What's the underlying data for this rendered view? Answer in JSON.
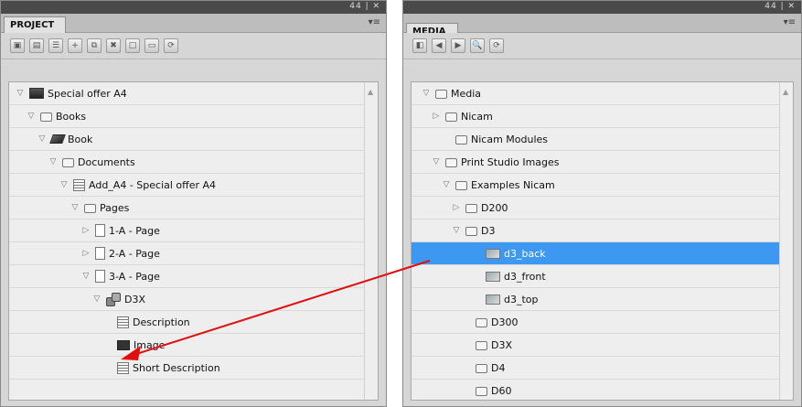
{
  "window_controls": "44 | ✕",
  "project_panel": {
    "tab_label": "PROJECT",
    "menu_icon": "▾≡",
    "toolbar_buttons": [
      "save-icon",
      "save-as-icon",
      "properties-icon",
      "add-icon",
      "duplicate-icon",
      "delete-icon",
      "new-page-icon",
      "preview-icon",
      "refresh-icon"
    ],
    "tree": [
      {
        "label": "Special offer A4",
        "icon": "dark-box-icon",
        "expander": "▽",
        "depth": 0
      },
      {
        "label": "Books",
        "icon": "folder-icon",
        "expander": "▽",
        "depth": 1
      },
      {
        "label": "Book",
        "icon": "book-icon",
        "expander": "▽",
        "depth": 2
      },
      {
        "label": "Documents",
        "icon": "folder-icon",
        "expander": "▽",
        "depth": 3
      },
      {
        "label": "Add_A4 - Special offer A4",
        "icon": "document-icon",
        "expander": "▽",
        "depth": 4
      },
      {
        "label": "Pages",
        "icon": "folder-icon",
        "expander": "▽",
        "depth": 5
      },
      {
        "label": "1-A - Page",
        "icon": "page-icon",
        "expander": "▷",
        "depth": 6
      },
      {
        "label": "2-A - Page",
        "icon": "page-icon",
        "expander": "▷",
        "depth": 6
      },
      {
        "label": "3-A - Page",
        "icon": "page-icon",
        "expander": "▽",
        "depth": 6
      },
      {
        "label": "D3X",
        "icon": "group-icon",
        "expander": "▽",
        "depth": 7
      },
      {
        "label": "Description",
        "icon": "text-icon",
        "expander": "",
        "depth": 8
      },
      {
        "label": "Image",
        "icon": "image-slot-icon",
        "expander": "",
        "depth": 8
      },
      {
        "label": "Short Description",
        "icon": "text-icon",
        "expander": "",
        "depth": 8
      }
    ]
  },
  "media_panel": {
    "tab_label": "MEDIA",
    "menu_icon": "▾≡",
    "toolbar_buttons": [
      "first-icon",
      "previous-icon",
      "next-icon",
      "search-icon",
      "refresh-icon"
    ],
    "tree": [
      {
        "label": "Media",
        "icon": "folder-icon",
        "expander": "▽",
        "depth": 0
      },
      {
        "label": "Nicam",
        "icon": "folder-icon",
        "expander": "▷",
        "depth": 1
      },
      {
        "label": "Nicam Modules",
        "icon": "folder-icon",
        "expander": "",
        "depth": 2
      },
      {
        "label": "Print Studio Images",
        "icon": "folder-icon",
        "expander": "▽",
        "depth": 1
      },
      {
        "label": "Examples Nicam",
        "icon": "folder-icon",
        "expander": "▽",
        "depth": 2
      },
      {
        "label": "D200",
        "icon": "folder-icon",
        "expander": "▷",
        "depth": 3
      },
      {
        "label": "D3",
        "icon": "folder-icon",
        "expander": "▽",
        "depth": 3
      },
      {
        "label": "d3_back",
        "icon": "image-icon",
        "expander": "",
        "depth": 5,
        "selected": true
      },
      {
        "label": "d3_front",
        "icon": "image-icon",
        "expander": "",
        "depth": 5
      },
      {
        "label": "d3_top",
        "icon": "image-icon",
        "expander": "",
        "depth": 5
      },
      {
        "label": "D300",
        "icon": "folder-icon",
        "expander": "",
        "depth": 4
      },
      {
        "label": "D3X",
        "icon": "folder-icon",
        "expander": "",
        "depth": 4
      },
      {
        "label": "D4",
        "icon": "folder-icon",
        "expander": "",
        "depth": 4
      },
      {
        "label": "D60",
        "icon": "folder-icon",
        "expander": "",
        "depth": 4
      }
    ]
  },
  "colors": {
    "selection": "#3d98f2",
    "arrow": "#e01010"
  }
}
